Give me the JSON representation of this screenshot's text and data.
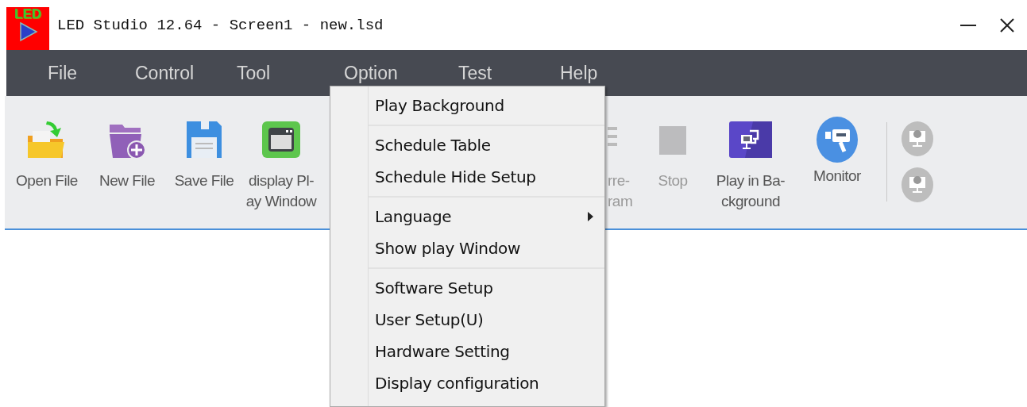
{
  "window": {
    "logo_text": "LED",
    "title": "LED Studio 12.64 - Screen1 - new.lsd"
  },
  "menu_bar": [
    "File",
    "Control",
    "Tool",
    "Option",
    "Test",
    "Help"
  ],
  "toolbar": [
    {
      "label": "Open File",
      "disabled": false
    },
    {
      "label": "New File",
      "disabled": false
    },
    {
      "label": "Save File",
      "disabled": false
    },
    {
      "label": "display Pl-\nay Window",
      "disabled": false
    },
    {
      "label": "rre-\nram",
      "disabled": true
    },
    {
      "label": "Stop",
      "disabled": true
    },
    {
      "label": "Play in Ba-\nckground",
      "disabled": false
    },
    {
      "label": "Monitor",
      "disabled": false
    }
  ],
  "option_menu": [
    [
      {
        "label": "Play Background",
        "submenu": false
      }
    ],
    [
      {
        "label": "Schedule Table",
        "submenu": false
      },
      {
        "label": "Schedule Hide Setup",
        "submenu": false
      }
    ],
    [
      {
        "label": "Language",
        "submenu": true
      },
      {
        "label": "Show play Window",
        "submenu": false
      }
    ],
    [
      {
        "label": "Software Setup",
        "submenu": false
      },
      {
        "label": "User Setup(U)",
        "submenu": false
      },
      {
        "label": "Hardware Setting",
        "submenu": false
      },
      {
        "label": "Display configuration",
        "submenu": false
      }
    ]
  ]
}
